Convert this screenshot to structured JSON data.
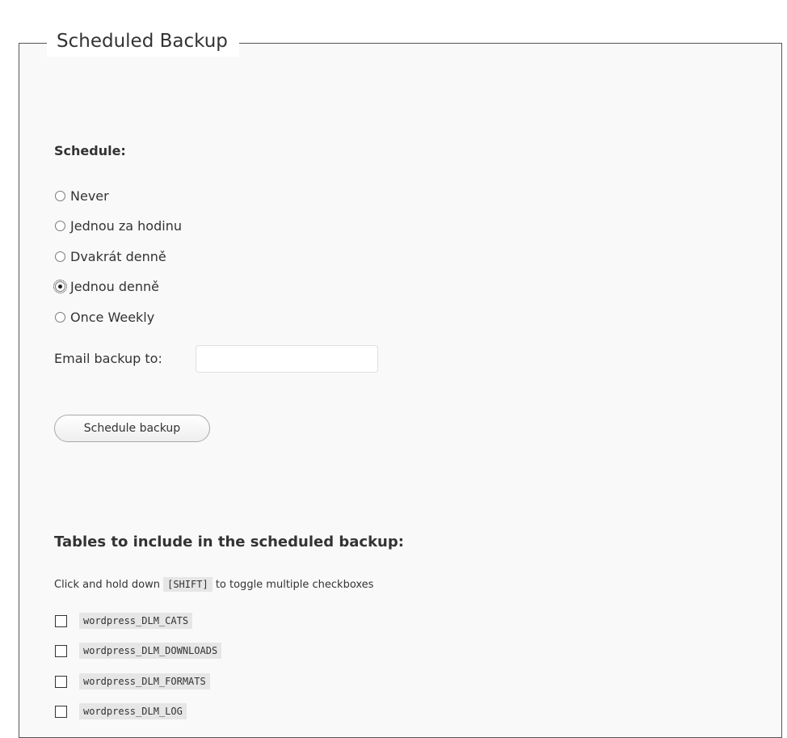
{
  "fieldset": {
    "legend": "Scheduled Backup"
  },
  "schedule": {
    "heading": "Schedule:",
    "options": [
      {
        "label": "Never",
        "checked": false
      },
      {
        "label": "Jednou za hodinu",
        "checked": false
      },
      {
        "label": "Dvakrát denně",
        "checked": false
      },
      {
        "label": "Jednou denně",
        "checked": true
      },
      {
        "label": "Once Weekly",
        "checked": false
      }
    ]
  },
  "email": {
    "label": "Email backup to:",
    "value": ""
  },
  "schedule_button": {
    "label": "Schedule backup"
  },
  "tables": {
    "heading": "Tables to include in the scheduled backup:",
    "hint_before": "Click and hold down",
    "hint_key": "[SHIFT]",
    "hint_after": "to toggle multiple checkboxes",
    "items": [
      {
        "name": "wordpress_DLM_CATS",
        "checked": false
      },
      {
        "name": "wordpress_DLM_DOWNLOADS",
        "checked": false
      },
      {
        "name": "wordpress_DLM_FORMATS",
        "checked": false
      },
      {
        "name": "wordpress_DLM_LOG",
        "checked": false
      }
    ]
  }
}
